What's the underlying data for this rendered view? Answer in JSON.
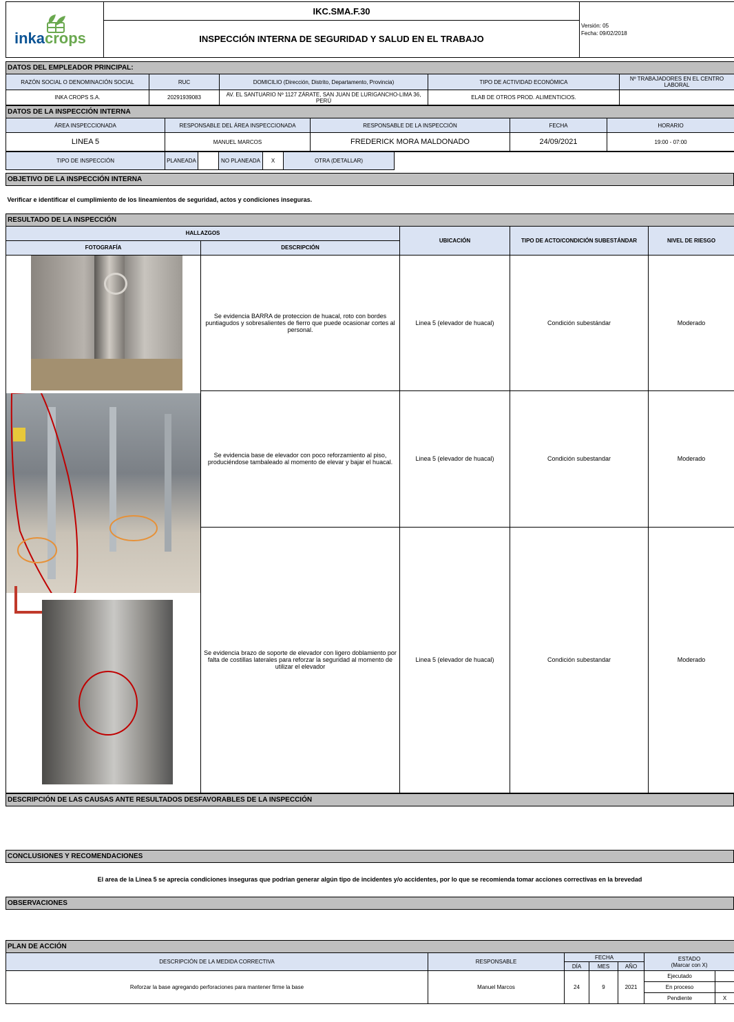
{
  "header": {
    "code": "IKC.SMA.F.30",
    "title": "INSPECCIÓN INTERNA DE SEGURIDAD Y SALUD EN EL TRABAJO",
    "version": "Versión: 05",
    "date": "Fecha: 09/02/2018",
    "logo_text_a": "inka",
    "logo_text_b": "crops"
  },
  "employer": {
    "section": "DATOS DEL EMPLEADOR PRINCIPAL:",
    "h_razon": "RAZÓN SOCIAL O DENOMINACIÓN SOCIAL",
    "h_ruc": "RUC",
    "h_domicilio": "DOMICILIO (Dirección, Distrito, Departamento, Provincia)",
    "h_actividad": "TIPO DE ACTIVIDAD ECONÓMICA",
    "h_trabajadores": "Nº TRABAJADORES EN EL CENTRO LABORAL",
    "razon": "INKA CROPS S.A.",
    "ruc": "20291939083",
    "domicilio": "AV. EL SANTUARIO Nº 1127 ZÁRATE, SAN JUAN DE LURIGANCHO-LIMA 36, PERÚ",
    "actividad": "ELAB DE OTROS PROD. ALIMENTICIOS.",
    "trabajadores": ""
  },
  "inspection": {
    "section": "DATOS DE LA INSPECCIÓN INTERNA",
    "h_area": "ÁREA INSPECCIONADA",
    "h_resp_area": "RESPONSABLE DEL ÁREA INSPECCIONADA",
    "h_resp_insp": "RESPONSABLE DE LA INSPECCIÓN",
    "h_fecha": "FECHA",
    "h_horario": "HORARIO",
    "area": "LINEA 5",
    "resp_area": "MANUEL MARCOS",
    "resp_insp": "FREDERICK MORA MALDONADO",
    "fecha": "24/09/2021",
    "horario": "19:00 - 07:00",
    "h_tipo": "TIPO DE INSPECCIÓN",
    "planeada": "PLANEADA",
    "planeada_mark": "",
    "no_planeada": "NO PLANEADA",
    "no_planeada_mark": "X",
    "otra": "OTRA (DETALLAR)",
    "otra_val": ""
  },
  "objective": {
    "section": "OBJETIVO DE LA INSPECCIÓN INTERNA",
    "text": "Verificar e identificar el cumplimiento de los lineamientos de seguridad, actos y condiciones inseguras."
  },
  "result": {
    "section": "RESULTADO DE LA INSPECCIÓN",
    "h_hallazgos": "HALLAZGOS",
    "h_foto": "FOTOGRAFÍA",
    "h_desc": "DESCRIPCIÓN",
    "h_ubic": "UBICACIÓN",
    "h_tipo": "TIPO DE ACTO/CONDICIÓN SUBESTÁNDAR",
    "h_nivel": "NIVEL DE RIESGO",
    "findings": [
      {
        "desc": "Se evidencia  BARRA de proteccion de huacal, roto con bordes puntiagudos y sobresalientes de fierro que puede ocasionar cortes al personal.",
        "ubic": "Linea 5 (elevador de huacal)",
        "tipo": "Condición subestándar",
        "nivel": "Moderado"
      },
      {
        "desc": "Se evidencia base de elevador con poco reforzamiento al piso, produciéndose tambaleado al momento de elevar y bajar el huacal.",
        "ubic": "Linea 5 (elevador de huacal)",
        "tipo": "Condición subestandar",
        "nivel": "Moderado"
      },
      {
        "desc": "Se evidencia brazo de soporte de elevador con ligero doblamiento por falta de costillas laterales para reforzar la seguridad al momento de utilizar el elevador",
        "ubic": "Linea 5 (elevador de huacal)",
        "tipo": "Condición subestandar",
        "nivel": "Moderado"
      }
    ]
  },
  "causes": {
    "section": "DESCRIPCIÓN DE LAS CAUSAS ANTE RESULTADOS DESFAVORABLES DE LA INSPECCIÓN",
    "text": ""
  },
  "conclusions": {
    "section": "CONCLUSIONES Y RECOMENDACIONES",
    "text": "El area de la Linea 5 se aprecia condiciones inseguras que podrian generar algún tipo de incidentes y/o accidentes, por lo que se recomienda tomar acciones correctivas en la brevedad"
  },
  "observations": {
    "section": "OBSERVACIONES",
    "text": ""
  },
  "plan": {
    "section": "PLAN DE ACCIÓN",
    "h_desc": "DESCRIPCIÓN DE LA MEDIDA CORRECTIVA",
    "h_resp": "RESPONSABLE",
    "h_fecha": "FECHA",
    "h_dia": "DÍA",
    "h_mes": "MES",
    "h_anio": "AÑO",
    "h_estado": "ESTADO",
    "h_estado_sub": "(Marcar con X)",
    "desc": "Reforzar la base agregando perforaciones para mantener firme la base",
    "resp": "Manuel Marcos",
    "dia": "24",
    "mes": "9",
    "anio": "2021",
    "estados": [
      {
        "label": "Ejecutado",
        "mark": ""
      },
      {
        "label": "En proceso",
        "mark": ""
      },
      {
        "label": "Pendiente",
        "mark": "X"
      }
    ]
  },
  "colors": {
    "header_blue": "#dae3f3",
    "section_gray": "#bfbfbf",
    "logo_green": "#6aa84f",
    "logo_blue": "#0b5394",
    "highlight_red": "#c00000",
    "highlight_orange": "#e69138"
  }
}
